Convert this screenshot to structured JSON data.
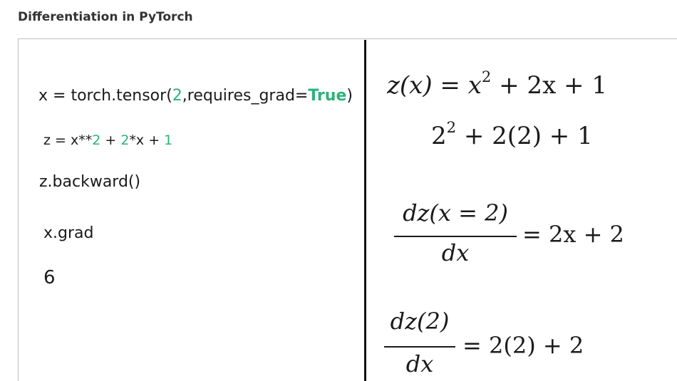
{
  "header": {
    "title": "Differentiation in PyTorch"
  },
  "code": {
    "line1": {
      "pre": "x = torch.tensor(",
      "arg": "2",
      "mid": ",requires_grad=",
      "flag": "True",
      "post": ")"
    },
    "line2": {
      "a": "z = x**",
      "b": "2",
      "c": " + ",
      "d": "2",
      "e": "*x + ",
      "f": "1"
    },
    "line3": "z.backward()",
    "line4": "x.grad",
    "output": "6"
  },
  "math": {
    "eq1": {
      "lhs": "z(x) = x",
      "exp": "2",
      "rest": " + 2x + 1"
    },
    "eq2": {
      "base": "2",
      "exp": "2",
      "rest": " + 2(2) + 1"
    },
    "eq3": {
      "num": "dz(x = 2)",
      "den": "dx",
      "rhs": "= 2x + 2"
    },
    "eq4": {
      "num": "dz(2)",
      "den": "dx",
      "rhs": "= 2(2) + 2"
    }
  },
  "colors": {
    "accent_green": "#2db37a",
    "divider": "#111111"
  }
}
